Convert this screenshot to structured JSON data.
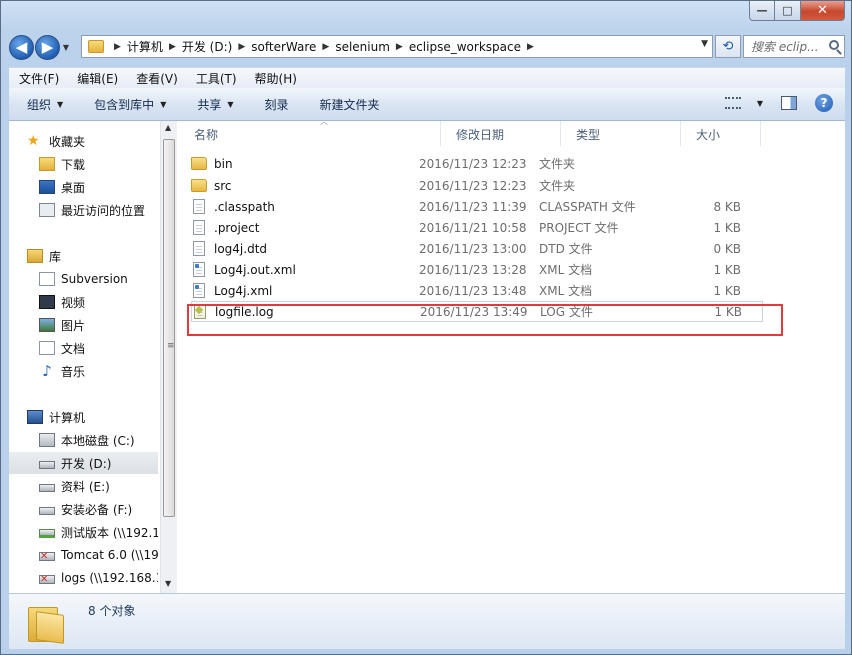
{
  "window": {
    "caption_buttons": {
      "minimize": "—",
      "maximize": "□",
      "close": "✕"
    }
  },
  "nav": {
    "back_icon": "◀",
    "forward_icon": "▶",
    "breadcrumbs": [
      "计算机",
      "开发 (D:)",
      "softerWare",
      "selenium",
      "eclipse_workspace"
    ],
    "search_placeholder": "搜索 eclip..."
  },
  "menubar": [
    "文件(F)",
    "编辑(E)",
    "查看(V)",
    "工具(T)",
    "帮助(H)"
  ],
  "toolbar": {
    "organize": "组织",
    "include_in_library": "包含到库中",
    "share": "共享",
    "burn": "刻录",
    "new_folder": "新建文件夹"
  },
  "navpane": {
    "favorites": {
      "label": "收藏夹",
      "items": [
        "下载",
        "桌面",
        "最近访问的位置"
      ]
    },
    "libraries": {
      "label": "库",
      "items": [
        "Subversion",
        "视频",
        "图片",
        "文档",
        "音乐"
      ]
    },
    "computer": {
      "label": "计算机",
      "items": [
        "本地磁盘 (C:)",
        "开发 (D:)",
        "资料 (E:)",
        "安装必备 (F:)",
        "测试版本 (\\\\192.1",
        "Tomcat 6.0 (\\\\192",
        "logs (\\\\192.168.1"
      ]
    },
    "selected": "开发 (D:)"
  },
  "columns": [
    "名称",
    "修改日期",
    "类型",
    "大小"
  ],
  "files": [
    {
      "name": "bin",
      "date": "2016/11/23 12:23",
      "type": "文件夹",
      "size": "",
      "kind": "folder"
    },
    {
      "name": "src",
      "date": "2016/11/23 12:23",
      "type": "文件夹",
      "size": "",
      "kind": "folder"
    },
    {
      "name": ".classpath",
      "date": "2016/11/23 11:39",
      "type": "CLASSPATH 文件",
      "size": "8 KB",
      "kind": "file"
    },
    {
      "name": ".project",
      "date": "2016/11/21 10:58",
      "type": "PROJECT 文件",
      "size": "1 KB",
      "kind": "file"
    },
    {
      "name": "log4j.dtd",
      "date": "2016/11/23 13:00",
      "type": "DTD 文件",
      "size": "0 KB",
      "kind": "file"
    },
    {
      "name": "Log4j.out.xml",
      "date": "2016/11/23 13:28",
      "type": "XML 文档",
      "size": "1 KB",
      "kind": "xml"
    },
    {
      "name": "Log4j.xml",
      "date": "2016/11/23 13:48",
      "type": "XML 文档",
      "size": "1 KB",
      "kind": "xml"
    },
    {
      "name": "logfile.log",
      "date": "2016/11/23 13:49",
      "type": "LOG 文件",
      "size": "1 KB",
      "kind": "log"
    }
  ],
  "status": {
    "count_text": "8 个对象"
  },
  "colors": {
    "highlight": "#e2393b",
    "window_frame": "#bcd3ec"
  }
}
